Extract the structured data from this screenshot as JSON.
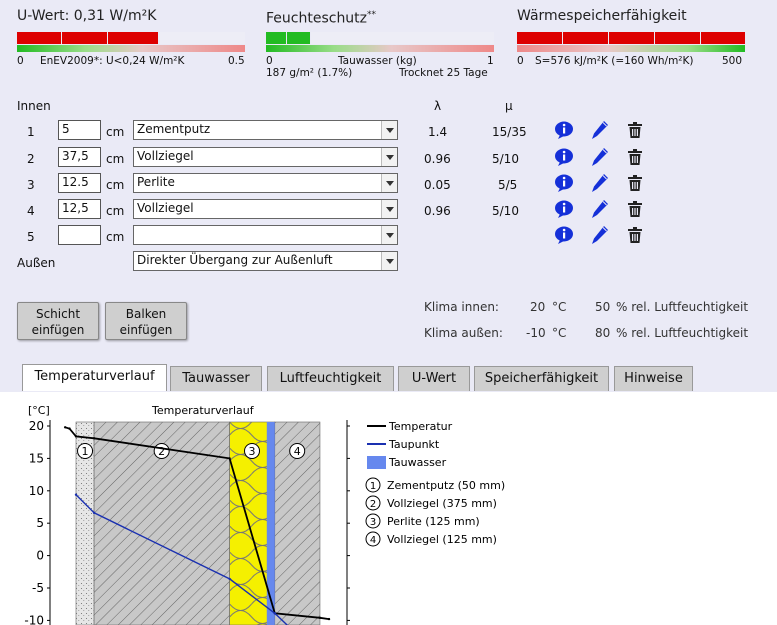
{
  "uvalue": {
    "title": "U-Wert: 0,31 W/m²K",
    "scale_min": "0",
    "scale_label": "EnEV2009*: U<0,24 W/m²K",
    "scale_max": "0.5"
  },
  "moisture": {
    "title": "Feuchteschutz",
    "sup": "**",
    "scale_min": "0",
    "scale_label": "Tauwasser (kg)",
    "scale_max": "1",
    "value_text": "187 g/m² (1.7%)",
    "dry_text": "Trocknet 25 Tage"
  },
  "heat": {
    "title": "Wärmespeicherfähigkeit",
    "scale_min": "0",
    "scale_label": "S=576 kJ/m²K (=160 Wh/m²K)",
    "scale_max": "500"
  },
  "layers": {
    "inner_label": "Innen",
    "outer_label": "Außen",
    "lambda_header": "λ",
    "mu_header": "μ",
    "unit": "cm",
    "rows": [
      {
        "num": "1",
        "thickness": "5",
        "material": "Zementputz",
        "lambda": "1.4",
        "mu": "15/35"
      },
      {
        "num": "2",
        "thickness": "37,5",
        "material": "Vollziegel",
        "lambda": "0.96",
        "mu": "5/10"
      },
      {
        "num": "3",
        "thickness": "12.5",
        "material": "Perlite",
        "lambda": "0.05",
        "mu": "5/5"
      },
      {
        "num": "4",
        "thickness": "12,5",
        "material": "Vollziegel",
        "lambda": "0.96",
        "mu": "5/10"
      },
      {
        "num": "5",
        "thickness": "",
        "material": "",
        "lambda": "",
        "mu": ""
      }
    ],
    "outer_select": "Direkter Übergang zur Außenluft"
  },
  "buttons": {
    "add_layer_1": "Schicht",
    "add_layer_2": "einfügen",
    "add_beam_1": "Balken",
    "add_beam_2": "einfügen"
  },
  "climate": {
    "inner_label": "Klima innen:",
    "inner_temp": "20",
    "inner_hum": "50",
    "outer_label": "Klima außen:",
    "outer_temp": "-10",
    "outer_hum": "80",
    "temp_unit": "°C",
    "hum_unit": "% rel. Luftfeuchtigkeit"
  },
  "tabs": [
    "Temperaturverlauf",
    "Tauwasser",
    "Luftfeuchtigkeit",
    "U-Wert",
    "Speicherfähigkeit",
    "Hinweise"
  ],
  "colors": {
    "red": "#dd0000",
    "green": "#22bb22",
    "info_blue": "#1530d8",
    "temp_line": "#000000",
    "dew_line": "#1a30b0",
    "condensate": "#6688ee",
    "insulation": "#f5f000"
  },
  "chart_data": {
    "type": "line",
    "title": "Temperaturverlauf",
    "ylabel": "[°C]",
    "ylim": [
      -10,
      20
    ],
    "yticks": [
      20,
      15,
      10,
      5,
      0,
      -5,
      -10
    ],
    "layer_numbers": [
      "1",
      "2",
      "3",
      "4"
    ],
    "legend": [
      {
        "kind": "line",
        "label": "Temperatur"
      },
      {
        "kind": "line",
        "label": "Taupunkt"
      },
      {
        "kind": "box",
        "label": "Tauwasser"
      },
      {
        "kind": "num",
        "num": "1",
        "label": "Zementputz (50 mm)"
      },
      {
        "kind": "num",
        "num": "2",
        "label": "Vollziegel (375 mm)"
      },
      {
        "kind": "num",
        "num": "3",
        "label": "Perlite (125 mm)"
      },
      {
        "kind": "num",
        "num": "4",
        "label": "Vollziegel (125 mm)"
      }
    ],
    "series": [
      {
        "name": "Temperatur",
        "x_mm": [
          -30,
          -18,
          0,
          50,
          425,
          550,
          675,
          700
        ],
        "y": [
          19.8,
          19.6,
          18.4,
          18.1,
          15.0,
          -8.9,
          -9.6,
          -9.8
        ]
      },
      {
        "name": "Taupunkt",
        "x_mm": [
          0,
          50,
          425,
          550,
          595
        ],
        "y": [
          9.4,
          6.6,
          -3.6,
          -8.9,
          -11.3
        ]
      }
    ]
  }
}
